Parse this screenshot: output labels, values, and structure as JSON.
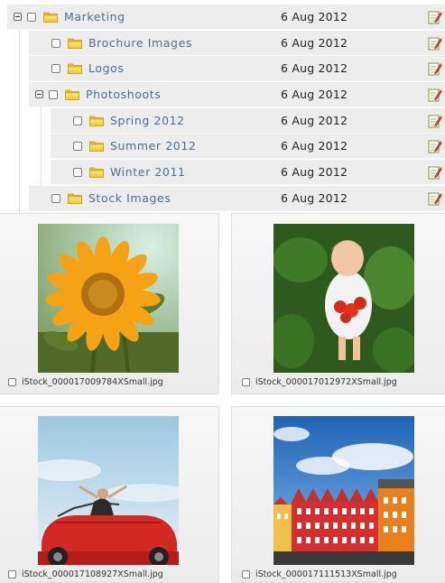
{
  "tree": {
    "rows": [
      {
        "name": "Marketing",
        "date": "6 Aug 2012"
      },
      {
        "name": "Brochure Images",
        "date": "6 Aug 2012"
      },
      {
        "name": "Logos",
        "date": "6 Aug 2012"
      },
      {
        "name": "Photoshoots",
        "date": "6 Aug 2012"
      },
      {
        "name": "Spring 2012",
        "date": "6 Aug 2012"
      },
      {
        "name": "Summer 2012",
        "date": "6 Aug 2012"
      },
      {
        "name": "Winter 2011",
        "date": "6 Aug 2012"
      },
      {
        "name": "Stock Images",
        "date": "6 Aug 2012"
      }
    ]
  },
  "images": [
    {
      "filename": "iStock_000017009784XSmall.jpg"
    },
    {
      "filename": "iStock_000017012972XSmall.jpg"
    },
    {
      "filename": "iStock_000017108927XSmall.jpg"
    },
    {
      "filename": "iStock_000017111513XSmall.jpg"
    }
  ],
  "icons": {
    "expander": "collapse-icon",
    "folder": "folder-icon",
    "edit": "edit-icon"
  },
  "colors": {
    "folder_name": "#4d6d8f",
    "row_background": "#ededed"
  }
}
